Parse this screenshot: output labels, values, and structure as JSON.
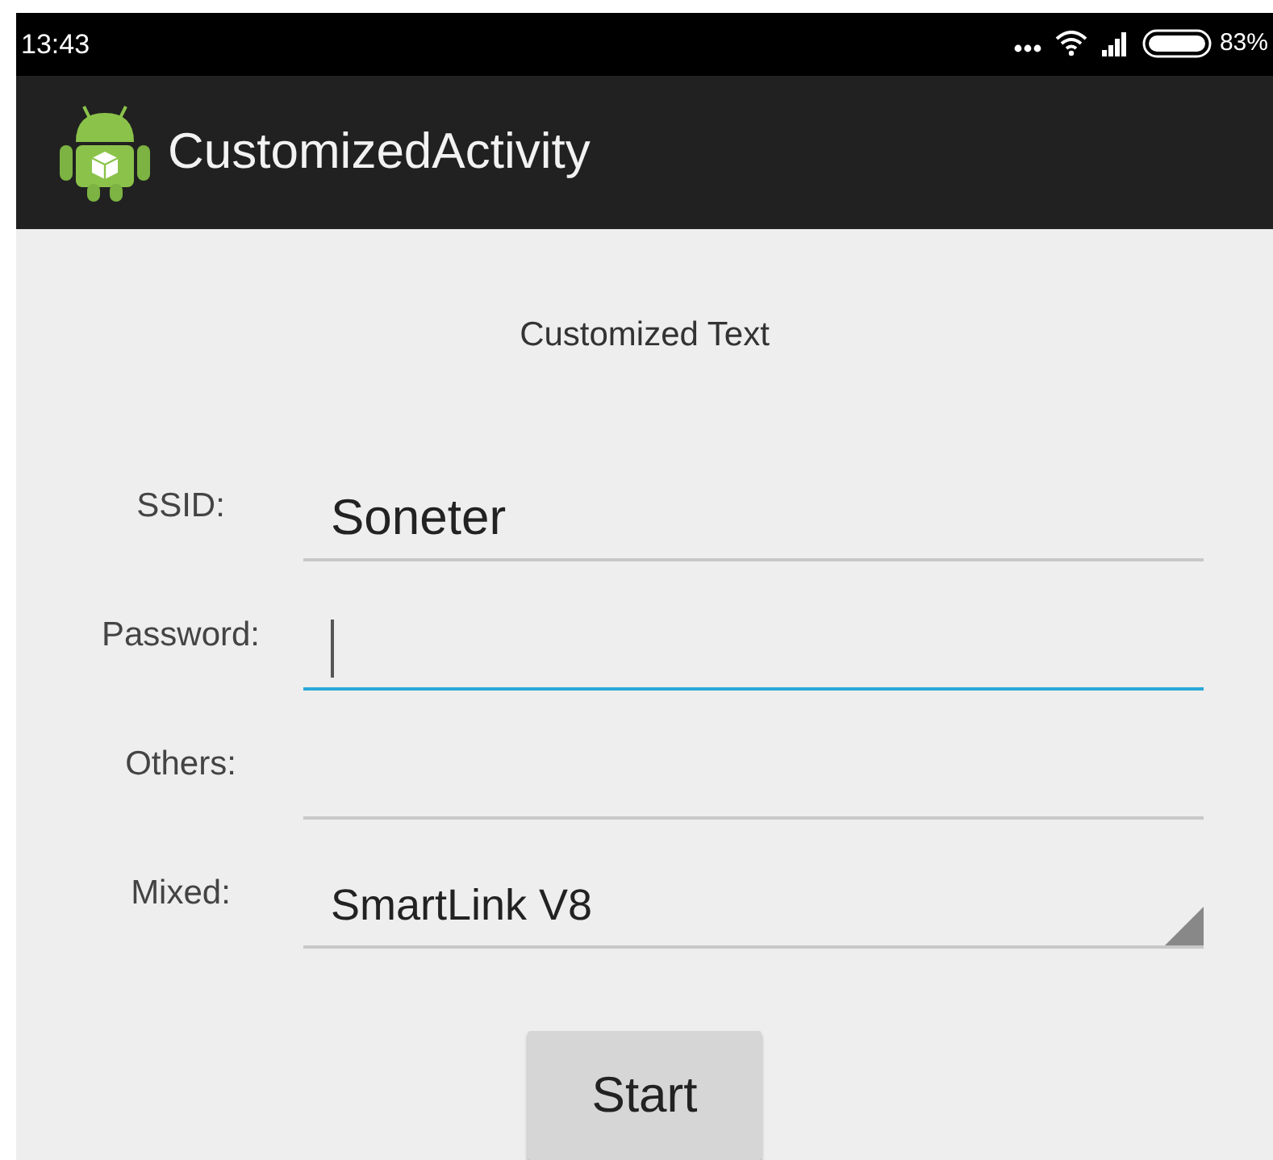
{
  "status_bar": {
    "time": "13:43",
    "battery": "83%"
  },
  "action_bar": {
    "title": "CustomizedActivity"
  },
  "heading": "Customized Text",
  "rows": [
    {
      "label": "SSID:",
      "kind": "field",
      "value": "Soneter",
      "focused": false
    },
    {
      "label": "Password:",
      "kind": "field",
      "value": "",
      "focused": true
    },
    {
      "label": "Others:",
      "kind": "field",
      "value": "",
      "focused": false
    },
    {
      "label": "Mixed:",
      "kind": "spinner",
      "value": "SmartLink V8",
      "focused": false
    }
  ],
  "button": "Start"
}
